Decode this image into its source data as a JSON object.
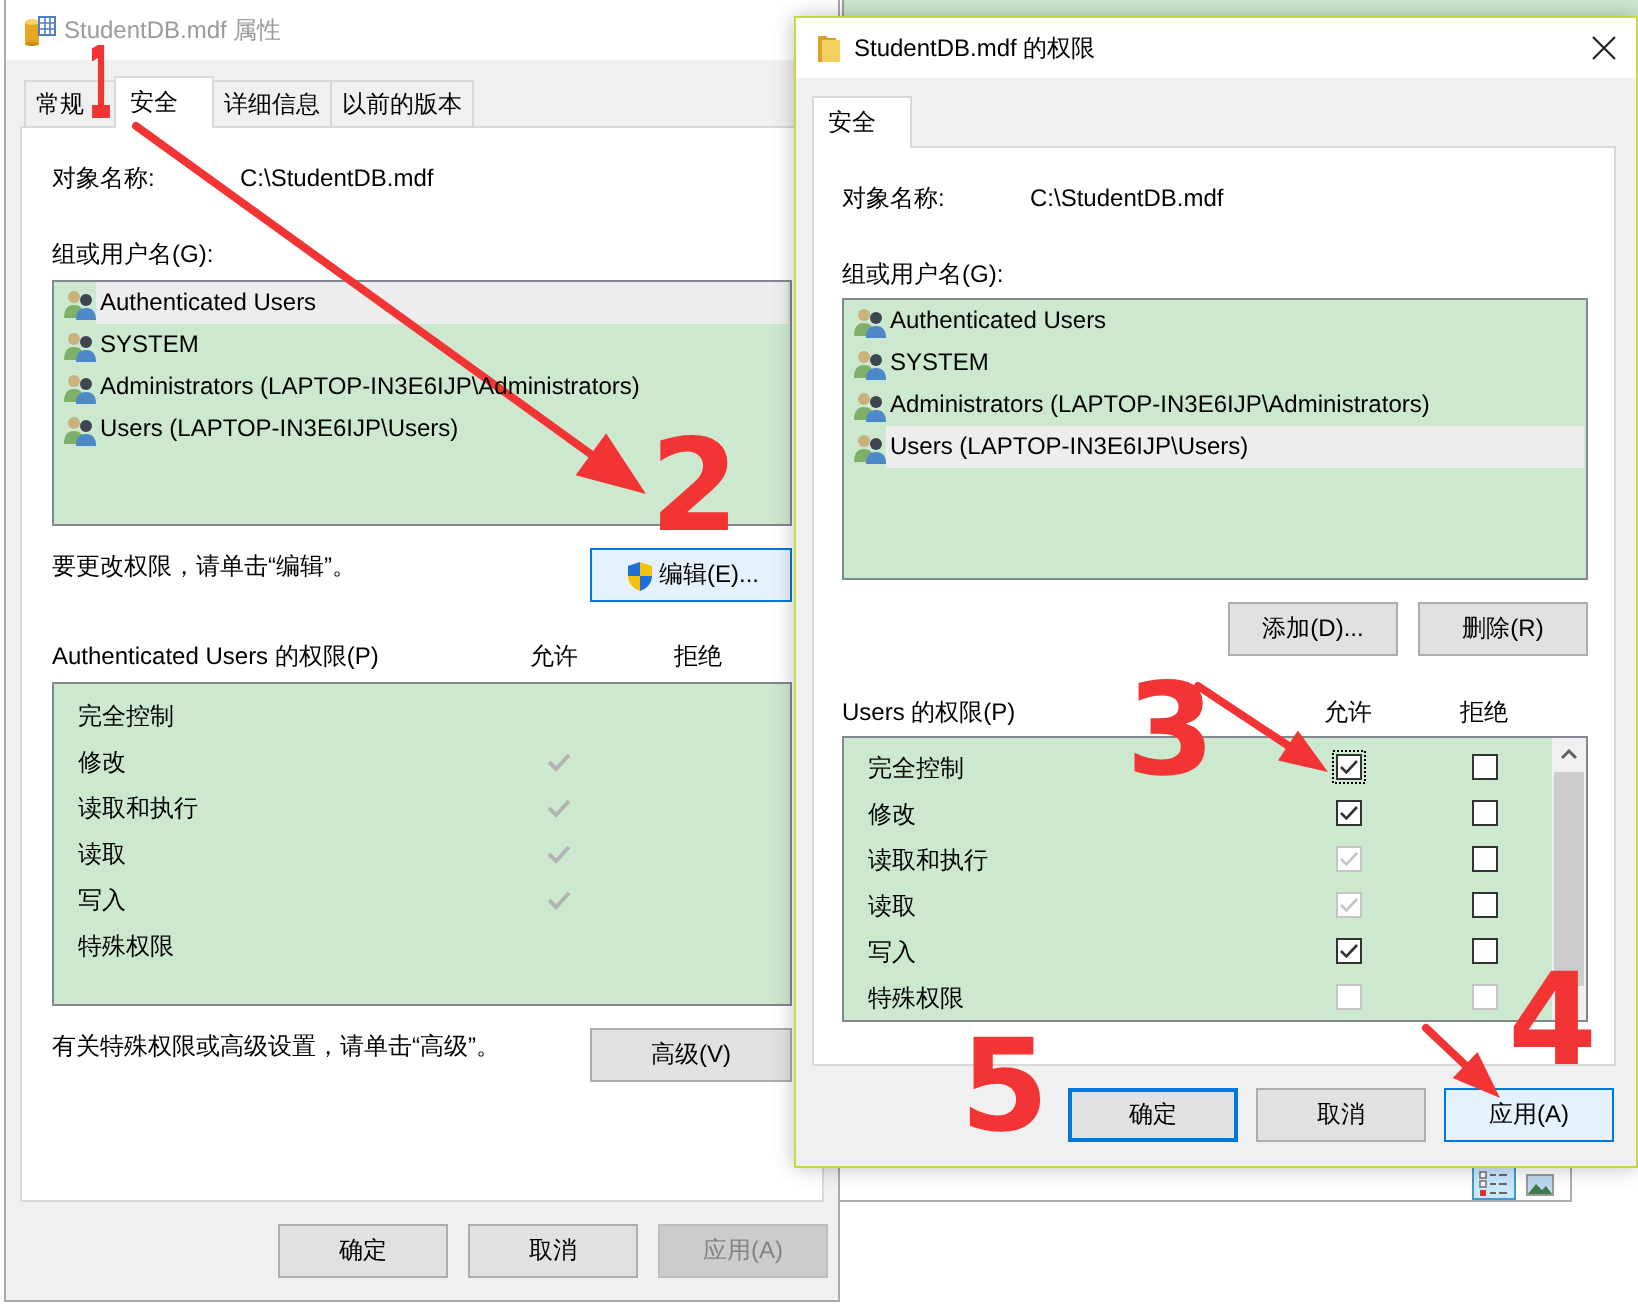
{
  "background_window": {
    "view_buttons": [
      {
        "kind": "details",
        "selected": true
      },
      {
        "kind": "picture",
        "selected": false
      }
    ]
  },
  "properties_dialog": {
    "title": "StudentDB.mdf 属性",
    "active": false,
    "tabs": [
      {
        "label": "常规",
        "selected": false
      },
      {
        "label": "安全",
        "selected": true
      },
      {
        "label": "详细信息",
        "selected": false
      },
      {
        "label": "以前的版本",
        "selected": false
      }
    ],
    "object_name_label": "对象名称:",
    "object_name": "C:\\StudentDB.mdf",
    "groups_label": "组或用户名(G):",
    "groups": [
      {
        "name": "Authenticated Users",
        "selected": true
      },
      {
        "name": "SYSTEM",
        "selected": false
      },
      {
        "name": "Administrators (LAPTOP-IN3E6IJP\\Administrators)",
        "selected": false
      },
      {
        "name": "Users (LAPTOP-IN3E6IJP\\Users)",
        "selected": false
      }
    ],
    "edit_hint": "要更改权限，请单击“编辑”。",
    "edit_button": {
      "label": "编辑(E)...",
      "hovered": true
    },
    "permissions_label": "Authenticated Users 的权限(P)",
    "allow_label": "允许",
    "deny_label": "拒绝",
    "permissions": [
      {
        "name": "完全控制",
        "allow": false,
        "deny": false
      },
      {
        "name": "修改",
        "allow": true,
        "deny": false
      },
      {
        "name": "读取和执行",
        "allow": true,
        "deny": false
      },
      {
        "name": "读取",
        "allow": true,
        "deny": false
      },
      {
        "name": "写入",
        "allow": true,
        "deny": false
      },
      {
        "name": "特殊权限",
        "allow": false,
        "deny": false
      }
    ],
    "advanced_hint": "有关特殊权限或高级设置，请单击“高级”。",
    "advanced_button": {
      "label": "高级(V)",
      "hovered": false
    },
    "buttons": [
      {
        "label": "确定",
        "disabled": false
      },
      {
        "label": "取消",
        "disabled": false
      },
      {
        "label": "应用(A)",
        "disabled": true
      }
    ]
  },
  "permissions_dialog": {
    "title": "StudentDB.mdf 的权限",
    "active": true,
    "tabs": [
      {
        "label": "安全",
        "selected": true
      }
    ],
    "object_name_label": "对象名称:",
    "object_name": "C:\\StudentDB.mdf",
    "groups_label": "组或用户名(G):",
    "groups": [
      {
        "name": "Authenticated Users",
        "selected": false
      },
      {
        "name": "SYSTEM",
        "selected": false
      },
      {
        "name": "Administrators (LAPTOP-IN3E6IJP\\Administrators)",
        "selected": false
      },
      {
        "name": "Users (LAPTOP-IN3E6IJP\\Users)",
        "selected": true
      }
    ],
    "add_button": "添加(D)...",
    "remove_button": "删除(R)",
    "permissions_label": "Users 的权限(P)",
    "allow_label": "允许",
    "deny_label": "拒绝",
    "permissions": [
      {
        "name": "完全控制",
        "allow": true,
        "allow_disabled": false,
        "deny": false,
        "deny_disabled": false,
        "focused": true
      },
      {
        "name": "修改",
        "allow": true,
        "allow_disabled": false,
        "deny": false,
        "deny_disabled": false,
        "focused": false
      },
      {
        "name": "读取和执行",
        "allow": true,
        "allow_disabled": true,
        "deny": false,
        "deny_disabled": false,
        "focused": false
      },
      {
        "name": "读取",
        "allow": true,
        "allow_disabled": true,
        "deny": false,
        "deny_disabled": false,
        "focused": false
      },
      {
        "name": "写入",
        "allow": true,
        "allow_disabled": false,
        "deny": false,
        "deny_disabled": false,
        "focused": false
      },
      {
        "name": "特殊权限",
        "allow": false,
        "allow_disabled": true,
        "deny": false,
        "deny_disabled": true,
        "focused": false
      }
    ],
    "buttons": [
      {
        "label": "确定",
        "default": true,
        "hovered": false
      },
      {
        "label": "取消",
        "default": false,
        "hovered": false
      },
      {
        "label": "应用(A)",
        "default": false,
        "hovered": true
      }
    ]
  },
  "annotations": [
    {
      "label": "1"
    },
    {
      "label": "2"
    },
    {
      "label": "3"
    },
    {
      "label": "4"
    },
    {
      "label": "5"
    }
  ]
}
